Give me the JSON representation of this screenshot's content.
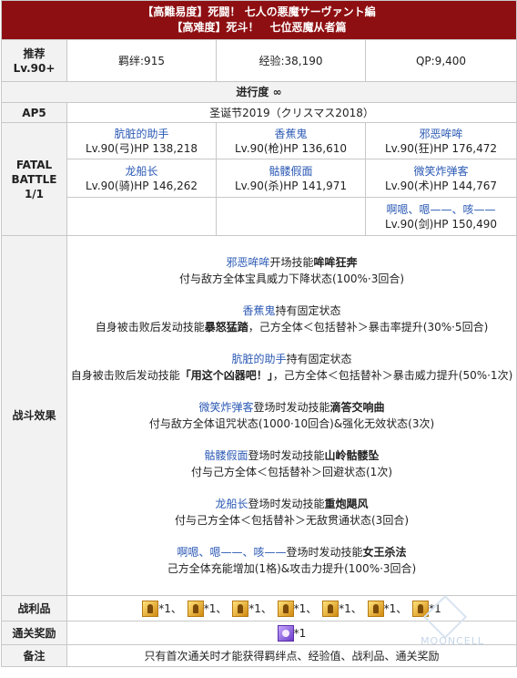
{
  "header": {
    "title_jp": "【高難易度】死闘！ 七人の悪魔サーヴァント編",
    "title_cn": "【高难度】死斗！　七位恶魔从者篇"
  },
  "recommend": {
    "label_line1": "推荐",
    "label_line2": "Lv.90+",
    "bond": "羁绊:915",
    "exp": "经验:38,190",
    "qp": "QP:9,400"
  },
  "progress": "进行度 ∞",
  "ap": {
    "label": "AP5",
    "event": "圣诞节2019（クリスマス2018）"
  },
  "battle": {
    "label_line1": "FATAL",
    "label_line2": "BATTLE",
    "label_line3": "1/1",
    "enemies": [
      {
        "name": "肮脏的助手",
        "stats": "Lv.90(弓)HP 138,218"
      },
      {
        "name": "香蕉鬼",
        "stats": "Lv.90(枪)HP 136,610"
      },
      {
        "name": "邪恶哞哞",
        "stats": "Lv.90(狂)HP 176,472"
      },
      {
        "name": "龙船长",
        "stats": "Lv.90(骑)HP 146,262"
      },
      {
        "name": "骷髅假面",
        "stats": "Lv.90(杀)HP 141,971"
      },
      {
        "name": "微笑炸弹客",
        "stats": "Lv.90(术)HP 144,767"
      },
      {
        "name": "啊嗯、嗯——、咳——",
        "stats": "Lv.90(剑)HP 150,490"
      }
    ]
  },
  "effects": {
    "label": "战斗效果",
    "items": [
      {
        "name": "邪恶哞哞",
        "intro": "开场技能",
        "skill": "哞哞狂奔",
        "detail": "付与敌方全体宝具威力下降状态(100%·3回合)"
      },
      {
        "name": "香蕉鬼",
        "intro": "持有固定状态",
        "skill": "",
        "detail_pre": "自身被击败后发动技能",
        "detail_skill": "暴怒猛踏",
        "detail_post": "，己方全体＜包括替补＞暴击率提升(30%·5回合)"
      },
      {
        "name": "肮脏的助手",
        "intro": "持有固定状态",
        "skill": "",
        "detail_pre": "自身被击败后发动技能",
        "detail_skill": "「用这个凶器吧！」",
        "detail_post": "，己方全体＜包括替补＞暴击威力提升(50%·1次)"
      },
      {
        "name": "微笑炸弹客",
        "intro": "登场时发动技能",
        "skill": "滴答交响曲",
        "detail": "付与敌方全体诅咒状态(1000·10回合)&强化无效状态(3次)"
      },
      {
        "name": "骷髅假面",
        "intro": "登场时发动技能",
        "skill": "山岭骷髅坠",
        "detail": "付与己方全体＜包括替补＞回避状态(1次)"
      },
      {
        "name": "龙船长",
        "intro": "登场时发动技能",
        "skill": "重炮飓风",
        "detail": "付与己方全体＜包括替补＞无敌贯通状态(3回合)"
      },
      {
        "name": "啊嗯、嗯——、咳——",
        "intro": "登场时发动技能",
        "skill": "女王杀法",
        "detail": "己方全体充能增加(1格)&攻击力提升(100%·3回合)"
      }
    ]
  },
  "drops": {
    "label": "战利品",
    "items": [
      {
        "icon": "gold-ember-icon",
        "count": "*1、"
      },
      {
        "icon": "gold-ember-icon",
        "count": "*1、"
      },
      {
        "icon": "gold-ember-icon",
        "count": "*1、"
      },
      {
        "icon": "gold-ember-icon",
        "count": "*1、"
      },
      {
        "icon": "gold-ember-icon",
        "count": "*1、"
      },
      {
        "icon": "gold-ember-icon",
        "count": "*1、"
      },
      {
        "icon": "gold-ember-icon",
        "count": "*1"
      }
    ]
  },
  "reward": {
    "label": "通关奖励",
    "icon": "saint-quartz-icon",
    "count": "*1"
  },
  "note": {
    "label": "备注",
    "text": "只有首次通关时才能获得羁绊点、经验值、战利品、通关奖励"
  },
  "watermark": "MOONCELL"
}
